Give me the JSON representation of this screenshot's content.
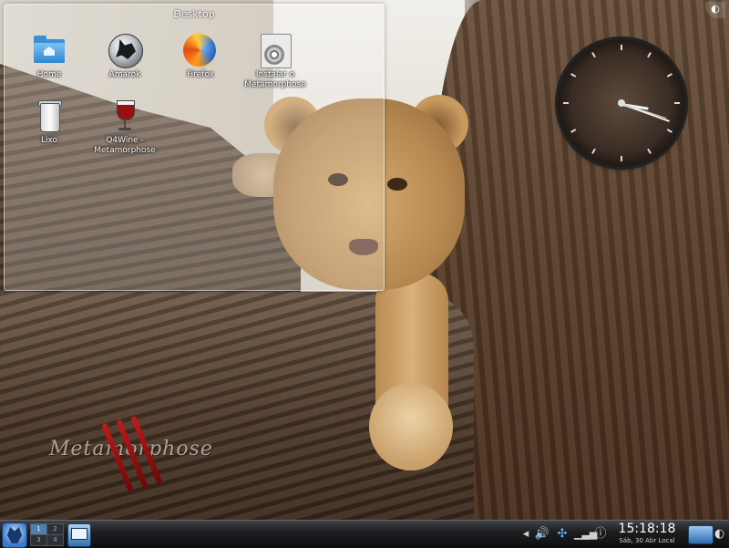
{
  "desktop": {
    "title": "Desktop",
    "icons": [
      {
        "label": "Home",
        "icon": "home-folder-icon"
      },
      {
        "label": "Amarok",
        "icon": "amarok-icon"
      },
      {
        "label": "Firefox",
        "icon": "firefox-icon"
      },
      {
        "label": "Instalar o Metamorphose",
        "icon": "installer-cd-icon"
      },
      {
        "label": "Lixo",
        "icon": "trash-icon"
      },
      {
        "label": "Q4Wine - Metamorphose",
        "icon": "wine-glass-icon"
      }
    ]
  },
  "wallpaper": {
    "subject": "lion cub on tree",
    "watermark": "Metamorphose"
  },
  "analog_clock": {
    "hour": 15,
    "minute": 18,
    "second": 18
  },
  "panel": {
    "pager_desktops": [
      "1",
      "2",
      "3",
      "4"
    ],
    "active_desktop": 1,
    "tray_icons": [
      "arrow-left-icon",
      "volume-icon",
      "network-icon",
      "wifi-signal-icon",
      "info-icon"
    ],
    "clock": {
      "time": "15:18:18",
      "date": "Sáb, 30 Abr Local"
    }
  },
  "colors": {
    "panel": "#1c1e20",
    "accent": "#3b78c9"
  }
}
